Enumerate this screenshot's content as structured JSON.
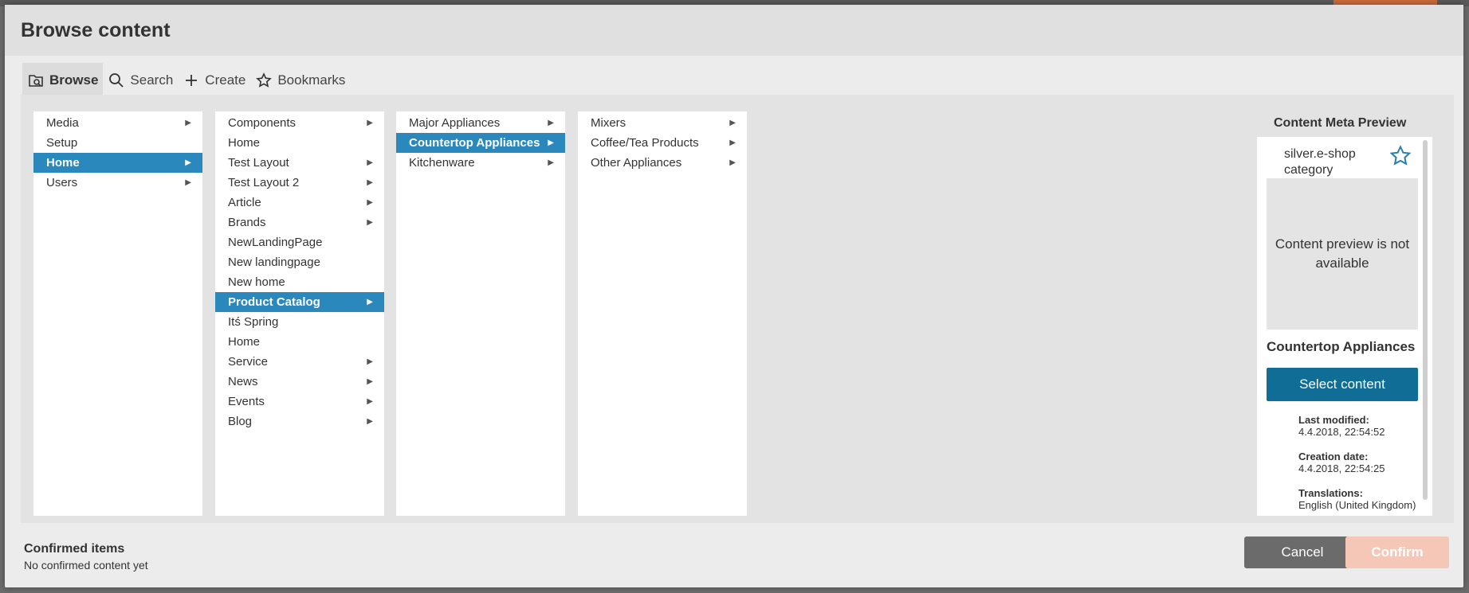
{
  "dialog": {
    "title": "Browse content"
  },
  "tabs": [
    {
      "label": "Browse",
      "icon": "browse-folder-icon",
      "active": true
    },
    {
      "label": "Search",
      "icon": "search-icon",
      "active": false
    },
    {
      "label": "Create",
      "icon": "plus-icon",
      "active": false
    },
    {
      "label": "Bookmarks",
      "icon": "star-icon",
      "active": false
    }
  ],
  "columns": [
    {
      "items": [
        {
          "label": "Media",
          "has_children": true,
          "selected": false
        },
        {
          "label": "Setup",
          "has_children": false,
          "selected": false
        },
        {
          "label": "Home",
          "has_children": true,
          "selected": true
        },
        {
          "label": "Users",
          "has_children": true,
          "selected": false
        }
      ]
    },
    {
      "items": [
        {
          "label": "Components",
          "has_children": true,
          "selected": false
        },
        {
          "label": "Home",
          "has_children": false,
          "selected": false
        },
        {
          "label": "Test Layout",
          "has_children": true,
          "selected": false
        },
        {
          "label": "Test Layout 2",
          "has_children": true,
          "selected": false
        },
        {
          "label": "Article",
          "has_children": true,
          "selected": false
        },
        {
          "label": "Brands",
          "has_children": true,
          "selected": false
        },
        {
          "label": "NewLandingPage",
          "has_children": false,
          "selected": false
        },
        {
          "label": "New landingpage",
          "has_children": false,
          "selected": false
        },
        {
          "label": "New home",
          "has_children": false,
          "selected": false
        },
        {
          "label": "Product Catalog",
          "has_children": true,
          "selected": true
        },
        {
          "label": "Itś Spring",
          "has_children": false,
          "selected": false
        },
        {
          "label": "Home",
          "has_children": false,
          "selected": false
        },
        {
          "label": "Service",
          "has_children": true,
          "selected": false
        },
        {
          "label": "News",
          "has_children": true,
          "selected": false
        },
        {
          "label": "Events",
          "has_children": true,
          "selected": false
        },
        {
          "label": "Blog",
          "has_children": true,
          "selected": false
        }
      ]
    },
    {
      "items": [
        {
          "label": "Major Appliances",
          "has_children": true,
          "selected": false
        },
        {
          "label": "Countertop Appliances",
          "has_children": true,
          "selected": true
        },
        {
          "label": "Kitchenware",
          "has_children": true,
          "selected": false
        }
      ]
    },
    {
      "items": [
        {
          "label": "Mixers",
          "has_children": true,
          "selected": false
        },
        {
          "label": "Coffee/Tea Products",
          "has_children": true,
          "selected": false
        },
        {
          "label": "Other Appliances",
          "has_children": true,
          "selected": false
        }
      ]
    }
  ],
  "meta": {
    "heading": "Content Meta Preview",
    "content_type": "silver.e-shop category",
    "bookmark_icon": "star-outline-icon",
    "preview_text": "Content preview is not available",
    "name": "Countertop Appliances",
    "select_label": "Select content",
    "last_modified_label": "Last modified:",
    "last_modified": "4.4.2018, 22:54:52",
    "creation_date_label": "Creation date:",
    "creation_date": "4.4.2018, 22:54:25",
    "translations_label": "Translations:",
    "translations": "English (United Kingdom)"
  },
  "footer": {
    "confirmed_title": "Confirmed items",
    "confirmed_sub": "No confirmed content yet",
    "cancel_label": "Cancel",
    "confirm_label": "Confirm"
  },
  "colors": {
    "selected": "#2a88bd",
    "primary_button": "#0f6d96",
    "cancel_button": "#6b6b6b",
    "confirm_disabled": "#f4c7b7"
  }
}
